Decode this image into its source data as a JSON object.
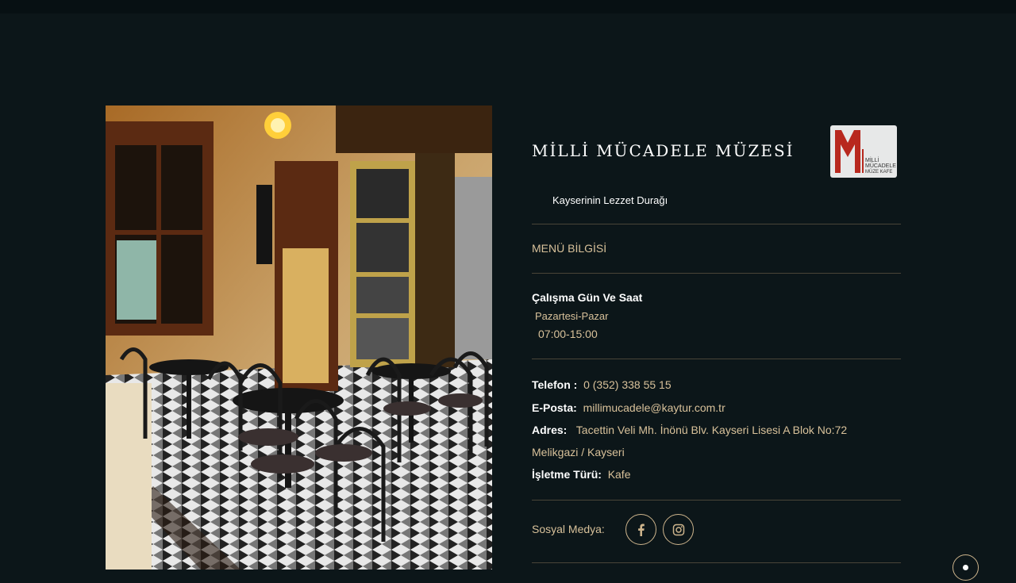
{
  "venue": {
    "title": "MİLLİ MÜCADELE MÜZESİ",
    "tagline": "Kayserinin Lezzet Durağı",
    "logo_text": [
      "MİLLİ",
      "MÜCADELE",
      "MÜZE KAFE"
    ]
  },
  "menu_section": {
    "label": "MENÜ BİLGİSİ"
  },
  "hours": {
    "title": "Çalışma Gün Ve Saat",
    "days": "Pazartesi-Pazar",
    "time": "07:00-15:00"
  },
  "contact": {
    "phone_label": "Telefon :",
    "phone": "0 (352) 338 55 15",
    "email_label": "E-Posta:",
    "email": "millimucadele@kaytur.com.tr",
    "address_label": "Adres:",
    "address_line1": "Tacettin Veli Mh. İnönü Blv. Kayseri Lisesi A Blok No:72",
    "address_line2": "Melikgazi / Kayseri",
    "type_label": "İşletme Türü:",
    "type": "Kafe"
  },
  "social": {
    "label": "Sosyal Medya:",
    "links": [
      {
        "icon": "facebook-icon"
      },
      {
        "icon": "instagram-icon"
      }
    ]
  },
  "colors": {
    "background": "#0c1619",
    "accent": "#d8c19a",
    "divider": "#4a4438",
    "logo_red": "#b8281e"
  }
}
